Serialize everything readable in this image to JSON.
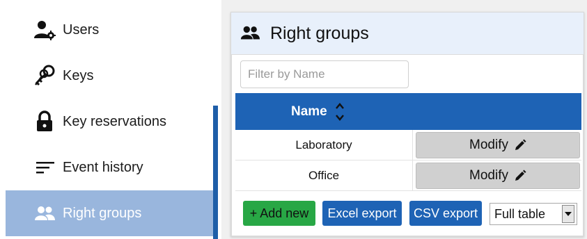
{
  "sidebar": {
    "items": [
      {
        "label": "Users",
        "icon": "user-gear-icon"
      },
      {
        "label": "Keys",
        "icon": "keys-icon"
      },
      {
        "label": "Key reservations",
        "icon": "lock-icon"
      },
      {
        "label": "Event history",
        "icon": "lines-icon"
      },
      {
        "label": "Right groups",
        "icon": "group-icon",
        "active": true
      }
    ]
  },
  "panel": {
    "title": "Right groups",
    "filter": {
      "placeholder": "Filter by Name",
      "value": ""
    },
    "table": {
      "column": "Name",
      "rows": [
        {
          "name": "Laboratory",
          "action": "Modify"
        },
        {
          "name": "Office",
          "action": "Modify"
        }
      ]
    },
    "buttons": {
      "add": "+ Add new",
      "excel": "Excel export",
      "csv": "CSV export"
    },
    "view_select": "Full table"
  },
  "colors": {
    "accent": "#1e63b5",
    "active_item": "#99b6dd",
    "add_button": "#28a745",
    "header_bg": "#e8f0fb"
  }
}
